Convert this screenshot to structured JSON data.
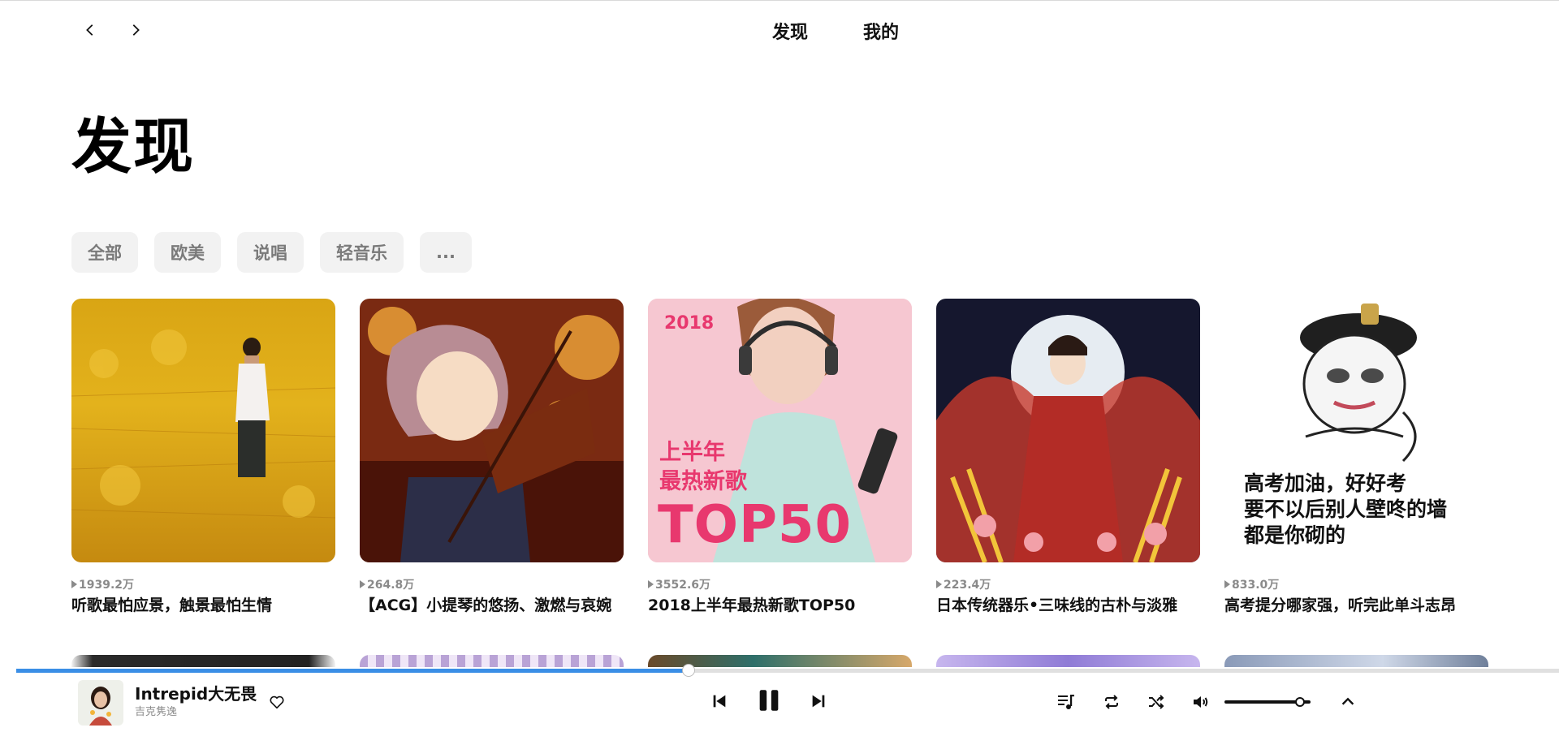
{
  "nav": {
    "back_icon": "chevron-left-icon",
    "forward_icon": "chevron-right-icon",
    "tabs": [
      {
        "label": "发现"
      },
      {
        "label": "我的"
      }
    ]
  },
  "page": {
    "title": "发现"
  },
  "categories": [
    {
      "label": "全部"
    },
    {
      "label": "欧美"
    },
    {
      "label": "说唱"
    },
    {
      "label": "轻音乐"
    },
    {
      "label": "..."
    }
  ],
  "playlists": [
    {
      "playcount": "1939.2万",
      "title": "听歌最怕应景，触景最怕生情"
    },
    {
      "playcount": "264.8万",
      "title": "【ACG】小提琴的悠扬、激燃与哀婉"
    },
    {
      "playcount": "3552.6万",
      "title": "2018上半年最热新歌TOP50",
      "cover_text": {
        "year": "2018",
        "line1": "上半年",
        "line2": "最热新歌",
        "line3": "TOP50"
      }
    },
    {
      "playcount": "223.4万",
      "title": "日本传统器乐•三味线的古朴与淡雅"
    },
    {
      "playcount": "833.0万",
      "title": "高考提分哪家强，听完此单斗志昂",
      "cover_text": {
        "line1": "高考加油，好好考",
        "line2": "要不以后别人壁咚的墙",
        "line3": "都是你砌的"
      }
    }
  ],
  "player": {
    "progress_fraction": 0.436,
    "song_title": "Intrepid大无畏",
    "artist": "吉克隽逸",
    "volume_fraction": 0.82,
    "icons": {
      "like": "heart-icon",
      "prev": "skip-previous-icon",
      "pause": "pause-icon",
      "next": "skip-next-icon",
      "queue": "playlist-music-icon",
      "repeat": "repeat-icon",
      "shuffle": "shuffle-icon",
      "volume": "volume-icon",
      "expand": "chevron-up-icon"
    }
  },
  "colors": {
    "accent": "#3a8ee6",
    "pill_bg": "#f2f2f2",
    "pink_title": "#e8386e"
  }
}
